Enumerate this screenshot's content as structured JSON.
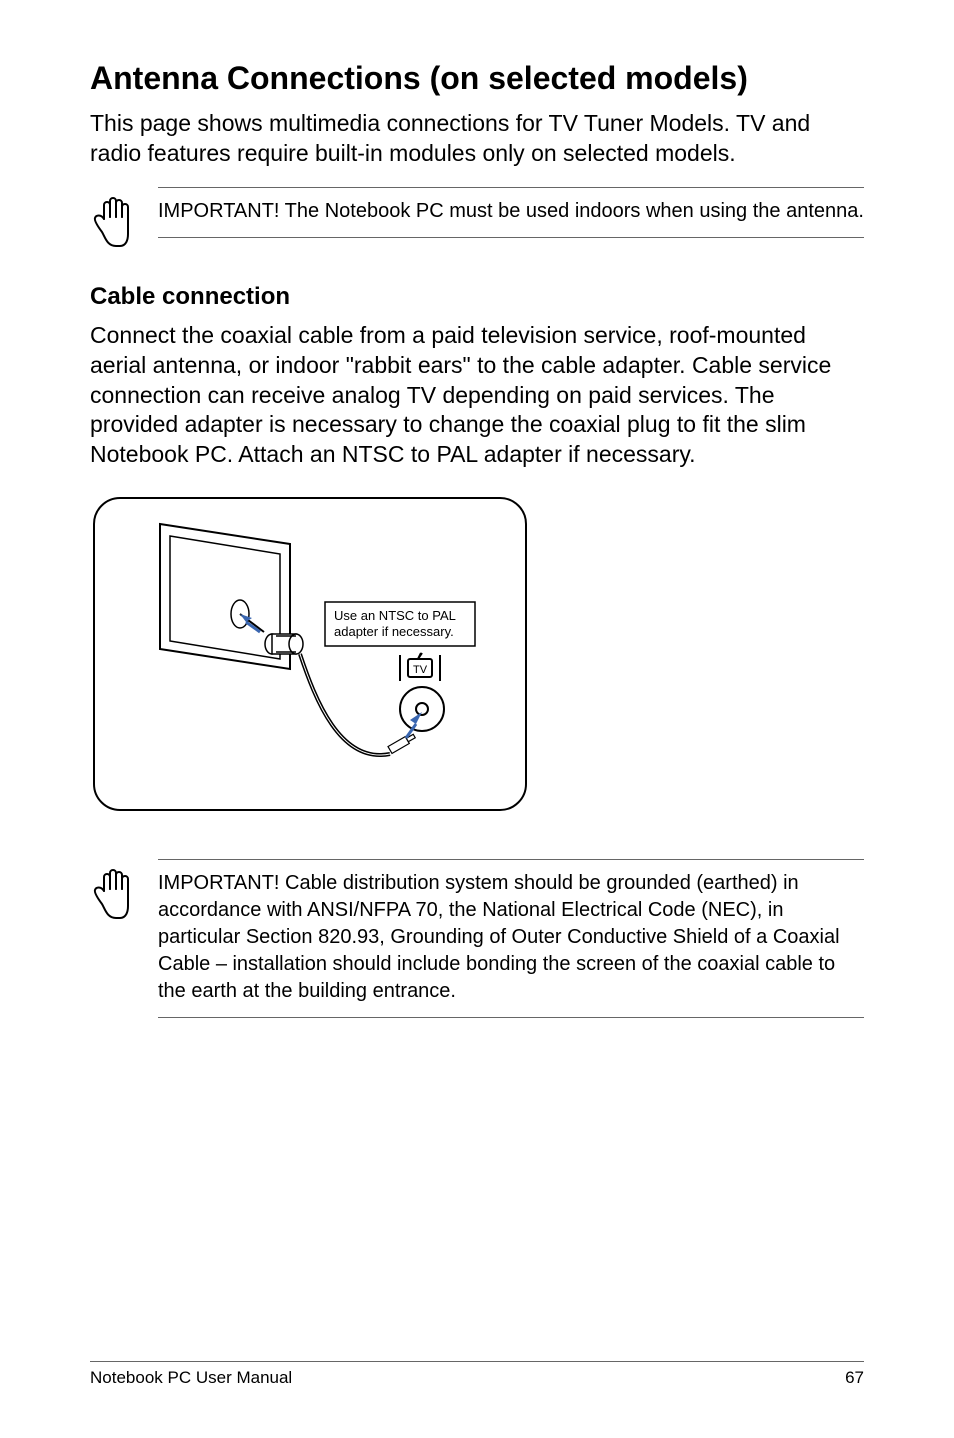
{
  "title": "Antenna Connections (on selected models)",
  "intro": "This page shows multimedia connections for TV Tuner Models. TV and radio features require built-in modules only on selected models.",
  "note1": "IMPORTANT! The Notebook PC must be used indoors when using the antenna.",
  "cable": {
    "heading": "Cable connection",
    "paragraph": "Connect the coaxial cable from a paid television service, roof-mounted aerial antenna, or indoor \"rabbit ears\" to the cable adapter. Cable service connection can receive analog TV depending on paid services. The provided adapter is necessary to change the coaxial plug to fit the slim Notebook PC. Attach an NTSC to PAL adapter if necessary."
  },
  "diagram": {
    "callout_line1": "Use an NTSC to PAL",
    "callout_line2": "adapter if necessary."
  },
  "note2": "IMPORTANT!  Cable distribution system should be grounded (earthed) in accordance with ANSI/NFPA 70, the National Electrical Code (NEC), in particular Section 820.93, Grounding of Outer Conductive Shield of a Coaxial Cable – installation should include bonding the screen of the coaxial cable to the earth at the building entrance.",
  "footer": {
    "left": "Notebook PC User Manual",
    "right": "67"
  }
}
